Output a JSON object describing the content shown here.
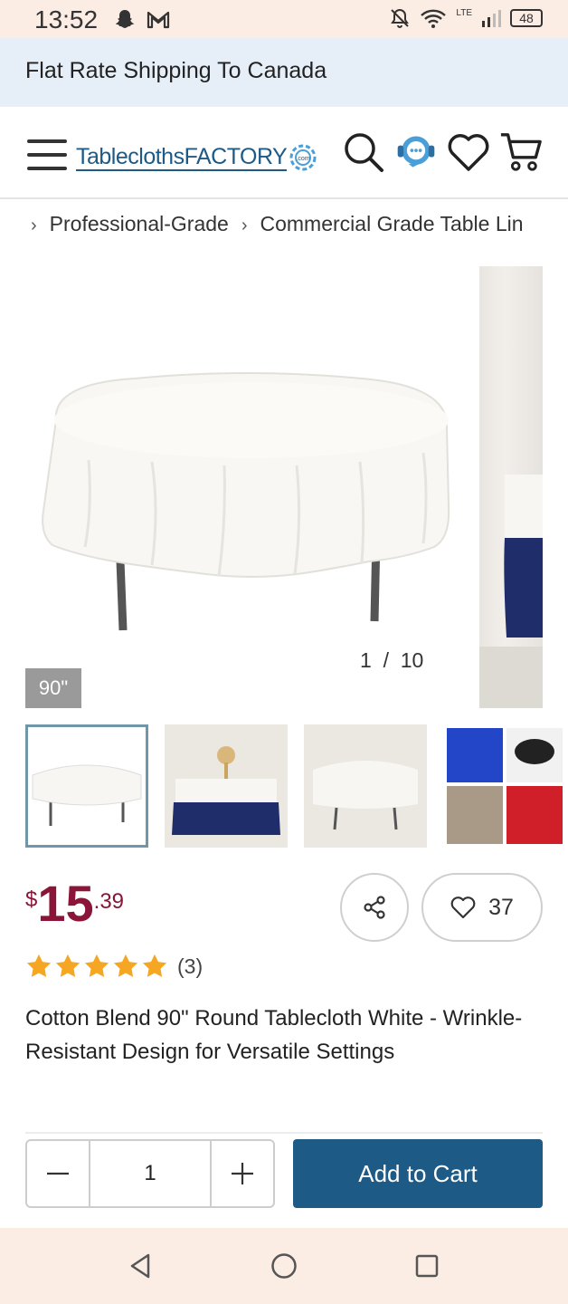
{
  "status_bar": {
    "time": "13:52",
    "network": "LTE",
    "battery": "48",
    "icons": [
      "snapchat-icon",
      "gmail-icon",
      "mute-icon",
      "wifi-icon",
      "signal-icon",
      "battery-icon"
    ]
  },
  "banner": {
    "text": "Flat Rate Shipping To Canada"
  },
  "header": {
    "logo_text": "TableclothsFACTORY",
    "logo_suffix": ".com",
    "icons": [
      "menu-icon",
      "search-icon",
      "chat-support-icon",
      "wishlist-heart-icon",
      "cart-icon"
    ]
  },
  "breadcrumb": {
    "items": [
      "Professional-Grade",
      "Commercial Grade Table Lin"
    ]
  },
  "gallery": {
    "counter": "1  /  10",
    "size_badge": "90\"",
    "thumbnail_count": 4
  },
  "price": {
    "currency": "$",
    "whole": "15",
    "cents": ".39"
  },
  "actions": {
    "favorites_count": "37"
  },
  "rating": {
    "stars": 5,
    "count": "(3)"
  },
  "product": {
    "title": "Cotton Blend 90\" Round Tablecloth White - Wrinkle-Resistant Design for Versatile Settings"
  },
  "cart": {
    "quantity": "1",
    "add_label": "Add to Cart"
  },
  "colors": {
    "brand_blue": "#1e5a86",
    "price_red": "#8a1538",
    "banner_bg": "#e6eef8",
    "star_gold": "#f5a623",
    "system_bar_bg": "#fbece4"
  }
}
